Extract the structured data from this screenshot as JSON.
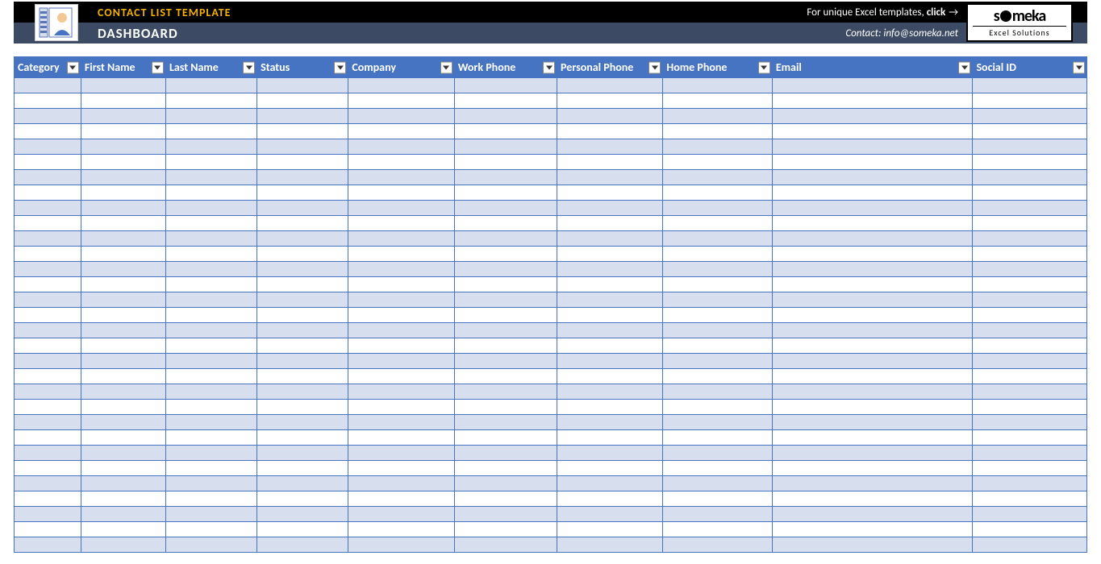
{
  "header": {
    "template_title": "CONTACT LIST TEMPLATE",
    "promo_prefix": "For unique Excel templates, ",
    "promo_bold": "click",
    "promo_arrow": "→",
    "dashboard_label": "DASHBOARD",
    "contact_label": "Contact: info@someka.net",
    "brand_name": "someka",
    "brand_tag": "Excel Solutions"
  },
  "columns": [
    "Category",
    "First Name",
    "Last Name",
    "Status",
    "Company",
    "Work Phone",
    "Personal Phone",
    "Home Phone",
    "Email",
    "Social ID"
  ],
  "row_count": 31
}
